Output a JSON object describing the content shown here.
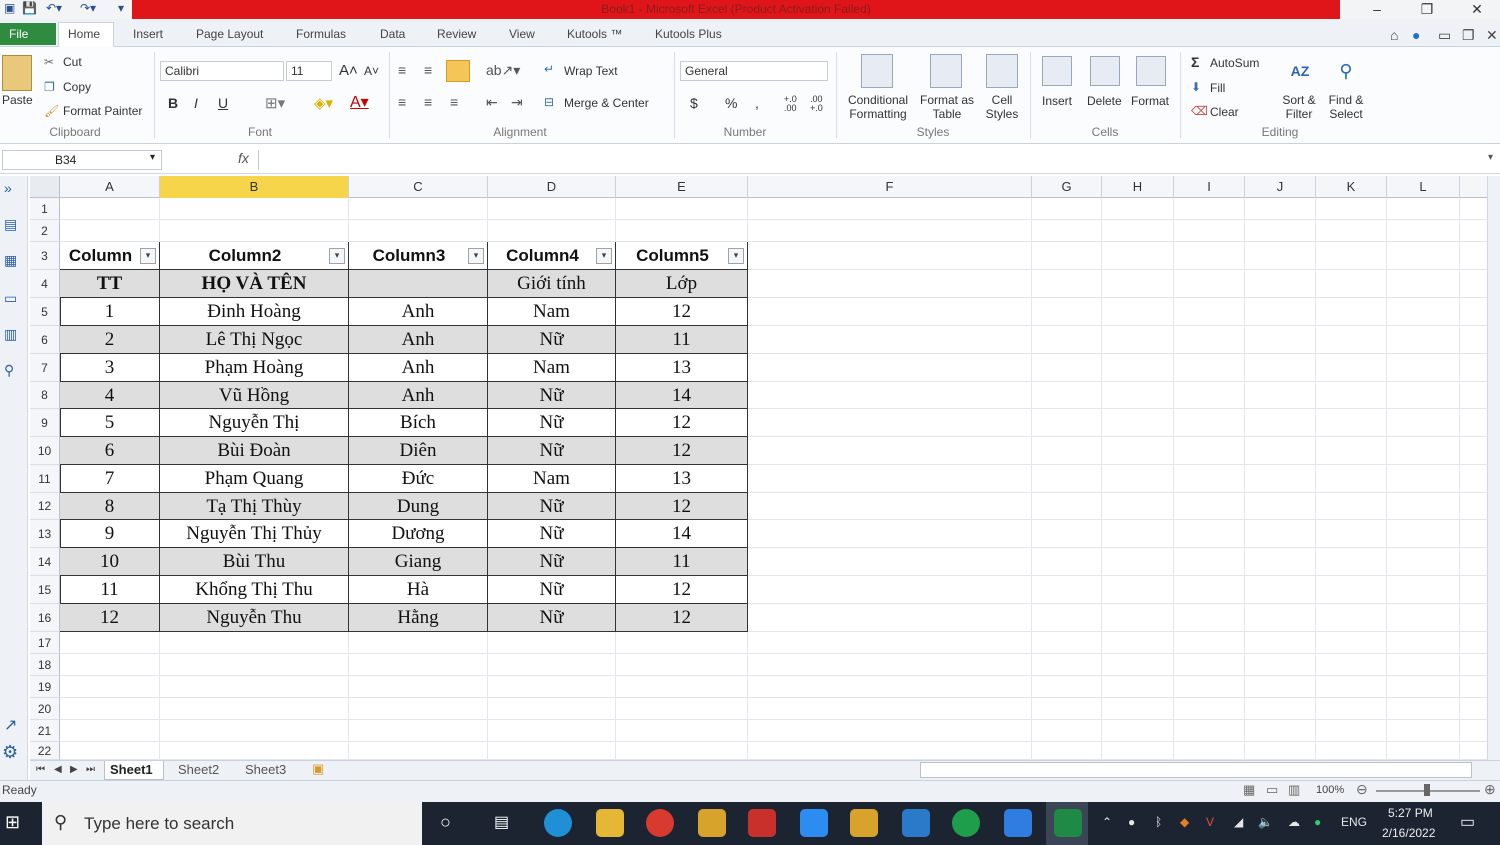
{
  "window": {
    "title": "Book1 - Microsoft Excel (Product Activation Failed)",
    "minimize": "–",
    "restore": "❐",
    "close": "✕"
  },
  "ribbon_tabs": {
    "file": "File",
    "home": "Home",
    "insert": "Insert",
    "page_layout": "Page Layout",
    "formulas": "Formulas",
    "data": "Data",
    "review": "Review",
    "view": "View",
    "kutools": "Kutools ™",
    "kutools_plus": "Kutools Plus"
  },
  "clipboard": {
    "paste": "Paste",
    "cut": "Cut",
    "copy": "Copy",
    "format_painter": "Format Painter",
    "group": "Clipboard"
  },
  "font": {
    "name": "Calibri",
    "size": "11",
    "group": "Font",
    "bold": "B",
    "italic": "I",
    "underline": "U"
  },
  "alignment": {
    "wrap_text": "Wrap Text",
    "merge_center": "Merge & Center",
    "group": "Alignment"
  },
  "number": {
    "format": "General",
    "currency": "$",
    "percent": "%",
    "comma": ",",
    "inc_dec": "+.0 .00",
    "dec_dec": ".00 +.0",
    "group": "Number"
  },
  "styles": {
    "conditional": "Conditional Formatting",
    "format_table": "Format as Table",
    "cell_styles": "Cell Styles",
    "group": "Styles"
  },
  "cells": {
    "insert": "Insert",
    "delete": "Delete",
    "format": "Format",
    "group": "Cells"
  },
  "editing": {
    "autosum": "AutoSum",
    "fill": "Fill",
    "clear": "Clear",
    "sort": "Sort & Filter",
    "find": "Find & Select",
    "group": "Editing"
  },
  "formula_bar": {
    "name_box": "B34",
    "fx": "fx",
    "value": ""
  },
  "columns": [
    "A",
    "B",
    "C",
    "D",
    "E",
    "F",
    "G",
    "H",
    "I",
    "J",
    "K",
    "L"
  ],
  "rows": [
    "1",
    "2",
    "3",
    "4",
    "5",
    "6",
    "7",
    "8",
    "9",
    "10",
    "11",
    "12",
    "13",
    "14",
    "15",
    "16",
    "17",
    "18",
    "19",
    "20",
    "21",
    "22"
  ],
  "table": {
    "headers": [
      "Column",
      "Column2",
      "Column3",
      "Column4",
      "Column5"
    ],
    "rows": [
      [
        "TT",
        "HỌ VÀ TÊN",
        "",
        "Giới tính",
        "Lớp"
      ],
      [
        "1",
        "Đinh Hoàng",
        "Anh",
        "Nam",
        "12"
      ],
      [
        "2",
        "Lê Thị Ngọc",
        "Anh",
        "Nữ",
        "11"
      ],
      [
        "3",
        "Phạm Hoàng",
        "Anh",
        "Nam",
        "13"
      ],
      [
        "4",
        "Vũ Hồng",
        "Anh",
        "Nữ",
        "14"
      ],
      [
        "5",
        "Nguyễn Thị",
        "Bích",
        "Nữ",
        "12"
      ],
      [
        "6",
        "Bùi Đoàn",
        "Diên",
        "Nữ",
        "12"
      ],
      [
        "7",
        "Phạm Quang",
        "Đức",
        "Nam",
        "13"
      ],
      [
        "8",
        "Tạ Thị Thùy",
        "Dung",
        "Nữ",
        "12"
      ],
      [
        "9",
        "Nguyễn Thị Thủy",
        "Dương",
        "Nữ",
        "14"
      ],
      [
        "10",
        "Bùi Thu",
        "Giang",
        "Nữ",
        "11"
      ],
      [
        "11",
        "Khổng Thị Thu",
        "Hà",
        "Nữ",
        "12"
      ],
      [
        "12",
        "Nguyễn Thu",
        "Hằng",
        "Nữ",
        "12"
      ]
    ]
  },
  "sheets": [
    "Sheet1",
    "Sheet2",
    "Sheet3"
  ],
  "status": {
    "ready": "Ready",
    "zoom": "100%"
  },
  "taskbar": {
    "search_placeholder": "Type here to search",
    "lang": "ENG",
    "time": "5:27 PM",
    "date": "2/16/2022"
  },
  "colors": {
    "accent_red": "#e0151a",
    "file_green": "#2f8b3f",
    "selected_col": "#f7d54a",
    "taskbar": "#1b2430"
  }
}
